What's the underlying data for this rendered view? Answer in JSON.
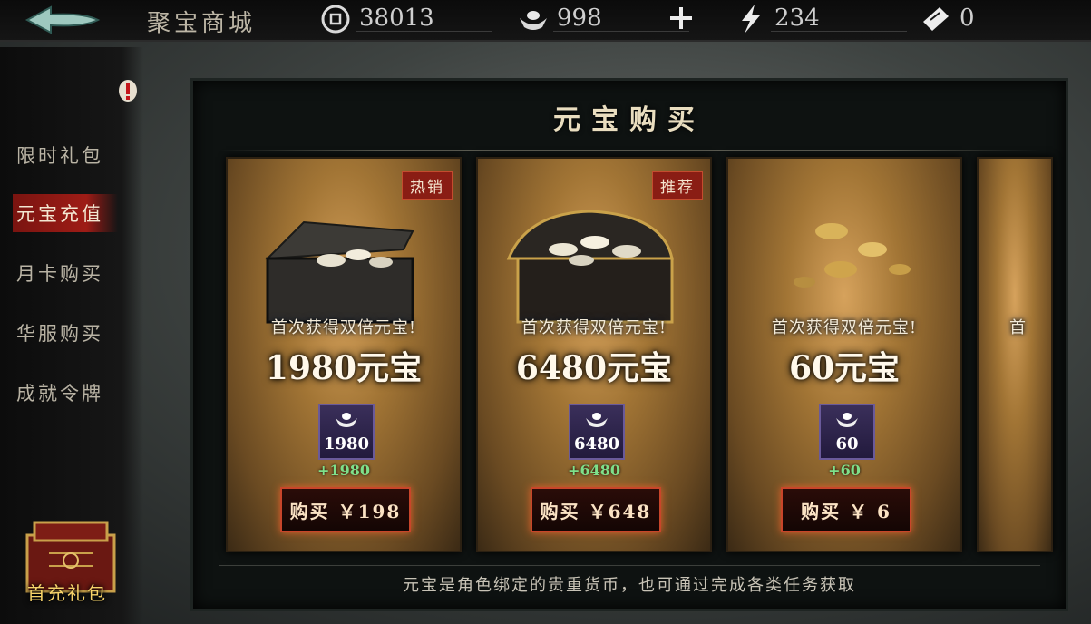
{
  "header": {
    "title": "聚宝商城",
    "back_icon": "back-arrow-icon",
    "resources": [
      {
        "name": "coin",
        "icon": "coin-icon",
        "value": "38013"
      },
      {
        "name": "ingot",
        "icon": "silver-ingot-icon",
        "value": "998"
      },
      {
        "name": "energy",
        "icon": "lightning-icon",
        "value": "234"
      },
      {
        "name": "ticket",
        "icon": "ticket-icon",
        "value": "0"
      }
    ],
    "plus_icon": "plus-icon"
  },
  "sidebar": {
    "items": [
      {
        "label": "限时礼包",
        "active": false,
        "alert": true
      },
      {
        "label": "元宝充值",
        "active": true
      },
      {
        "label": "月卡购买",
        "active": false
      },
      {
        "label": "华服购买",
        "active": false
      },
      {
        "label": "成就令牌",
        "active": false
      }
    ],
    "gift_label": "首充礼包"
  },
  "panel": {
    "title": "元宝购买",
    "footer": "元宝是角色绑定的贵重货币，也可通过完成各类任务获取",
    "cards": [
      {
        "tag": "热销",
        "first_buy": "首次获得双倍元宝!",
        "amount": "1980元宝",
        "gem_value": "1980",
        "bonus": "+1980",
        "buy": "购买 ￥198"
      },
      {
        "tag": "推荐",
        "first_buy": "首次获得双倍元宝!",
        "amount": "6480元宝",
        "gem_value": "6480",
        "bonus": "+6480",
        "buy": "购买 ￥648"
      },
      {
        "tag": "",
        "first_buy": "首次获得双倍元宝!",
        "amount": "60元宝",
        "gem_value": "60",
        "bonus": "+60",
        "buy": "购买 ￥ 6"
      },
      {
        "first_buy": "首"
      }
    ]
  },
  "colors": {
    "accent_red": "#9e1c16",
    "bonus_green": "#7fe08a",
    "gem_purple": "#2c2248",
    "title_gold": "#e9ddbf"
  }
}
